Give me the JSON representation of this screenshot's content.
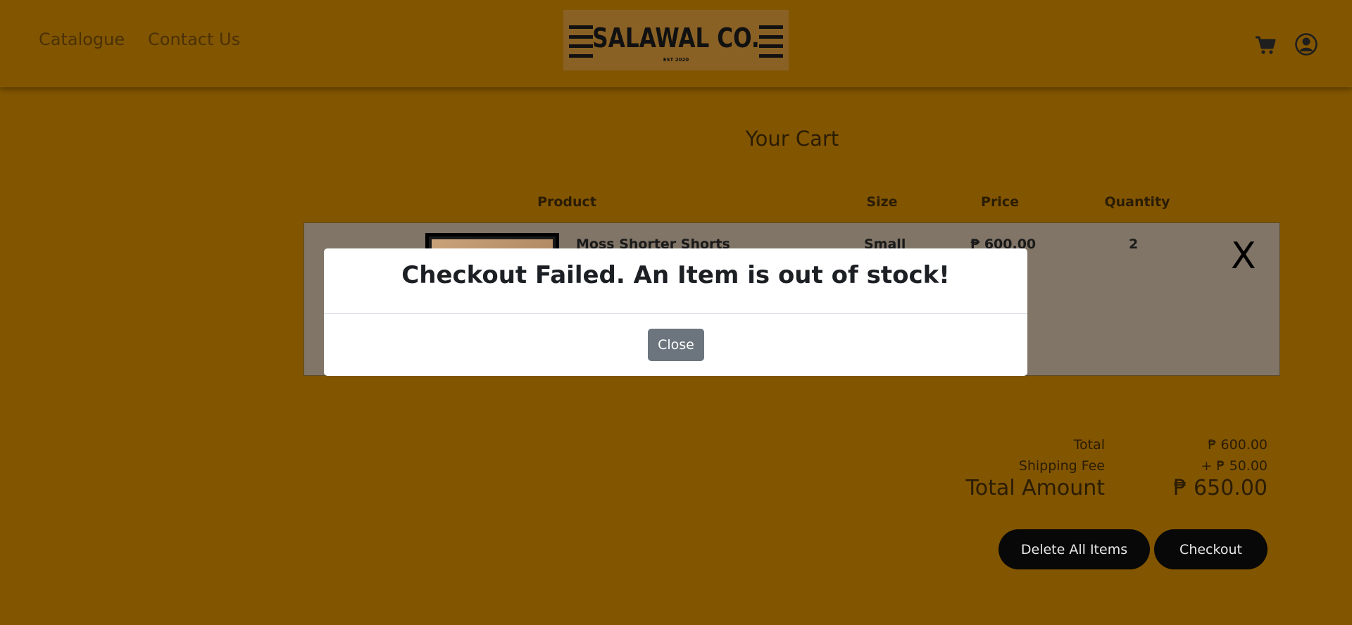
{
  "nav": {
    "links": [
      "Catalogue",
      "Contact Us"
    ],
    "logo_text": "SALAWAL CO.",
    "logo_sub": "EST 2020"
  },
  "icons": {
    "cart": "cart-icon",
    "account": "account-icon"
  },
  "cart": {
    "title": "Your Cart",
    "headers": {
      "product": "Product",
      "size": "Size",
      "price": "Price",
      "quantity": "Quantity"
    },
    "items": [
      {
        "name": "Moss Shorter Shorts",
        "size": "Small",
        "price": "₱ 600.00",
        "quantity": "2",
        "remove": "X"
      }
    ],
    "summary": {
      "total_label": "Total",
      "total_value": "₱ 600.00",
      "shipping_label": "Shipping Fee",
      "shipping_value": "+ ₱ 50.00",
      "amount_label": "Total Amount",
      "amount_value": "₱ 650.00"
    },
    "actions": {
      "delete_all": "Delete All Items",
      "checkout": "Checkout"
    }
  },
  "modal": {
    "title": "Checkout Failed. An Item is out of stock!",
    "close": "Close"
  },
  "colors": {
    "background": "#825500",
    "row": "#807567",
    "button_dark": "#080808",
    "button_close": "#6c757d"
  }
}
